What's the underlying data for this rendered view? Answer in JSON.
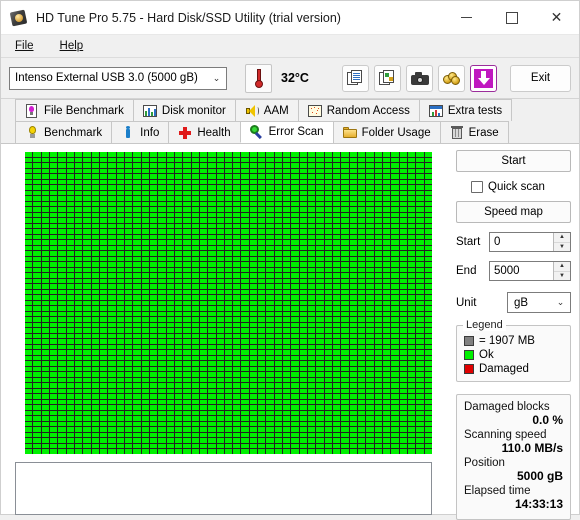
{
  "window": {
    "title": "HD Tune Pro 5.75 - Hard Disk/SSD Utility (trial version)",
    "icon": "harddisk-icon",
    "minimize": "─",
    "maximize": "□",
    "close": "✕"
  },
  "menu": {
    "items": [
      {
        "label": "File"
      },
      {
        "label": "Help"
      }
    ]
  },
  "toolbar": {
    "drive": "Intenso External USB 3.0 (5000 gB)",
    "dropdown_caret": "⌄",
    "temperature": "32°C",
    "buttons": [
      {
        "name": "copy-text-button",
        "title": "copy-text-icon"
      },
      {
        "name": "copy-image-button",
        "title": "copy-image-icon"
      },
      {
        "name": "screenshot-button",
        "title": "camera-icon"
      },
      {
        "name": "buy-button",
        "title": "coins-icon"
      },
      {
        "name": "download-button",
        "title": "download-arrow-icon"
      }
    ],
    "exit_label": "Exit"
  },
  "tabs": {
    "row1": [
      {
        "label": "File Benchmark",
        "icon": "file-benchmark-icon",
        "active": false
      },
      {
        "label": "Disk monitor",
        "icon": "disk-monitor-icon",
        "active": false
      },
      {
        "label": "AAM",
        "icon": "aam-speaker-icon",
        "active": false
      },
      {
        "label": "Random Access",
        "icon": "random-access-icon",
        "active": false
      },
      {
        "label": "Extra tests",
        "icon": "extra-tests-icon",
        "active": false
      }
    ],
    "row2": [
      {
        "label": "Benchmark",
        "icon": "lightbulb-icon",
        "active": false
      },
      {
        "label": "Info",
        "icon": "info-icon",
        "active": false
      },
      {
        "label": "Health",
        "icon": "health-cross-icon",
        "active": false
      },
      {
        "label": "Error Scan",
        "icon": "magnifier-icon",
        "active": true
      },
      {
        "label": "Folder Usage",
        "icon": "folder-icon",
        "active": false
      },
      {
        "label": "Erase",
        "icon": "trash-icon",
        "active": false
      }
    ]
  },
  "panel": {
    "start_button": "Start",
    "quick_scan_label": "Quick scan",
    "quick_scan_checked": false,
    "speed_map_button": "Speed map",
    "start_label": "Start",
    "start_value": "0",
    "end_label": "End",
    "end_value": "5000",
    "unit_label": "Unit",
    "unit_value": "gB",
    "spin_up": "▲",
    "spin_down": "▼"
  },
  "legend": {
    "caption": "Legend",
    "block_size": "= 1907 MB",
    "ok_label": "Ok",
    "damaged_label": "Damaged",
    "block_color": "#808080",
    "ok_color": "#00f000",
    "damaged_color": "#e00000"
  },
  "stats": {
    "damaged_blocks_label": "Damaged blocks",
    "damaged_blocks_value": "0.0 %",
    "scanning_speed_label": "Scanning speed",
    "scanning_speed_value": "110.0 MB/s",
    "position_label": "Position",
    "position_value": "5000 gB",
    "elapsed_time_label": "Elapsed time",
    "elapsed_time_value": "14:33:13"
  },
  "map": {
    "columns": 49,
    "rows": 55,
    "status": "ok",
    "log_text": ""
  }
}
